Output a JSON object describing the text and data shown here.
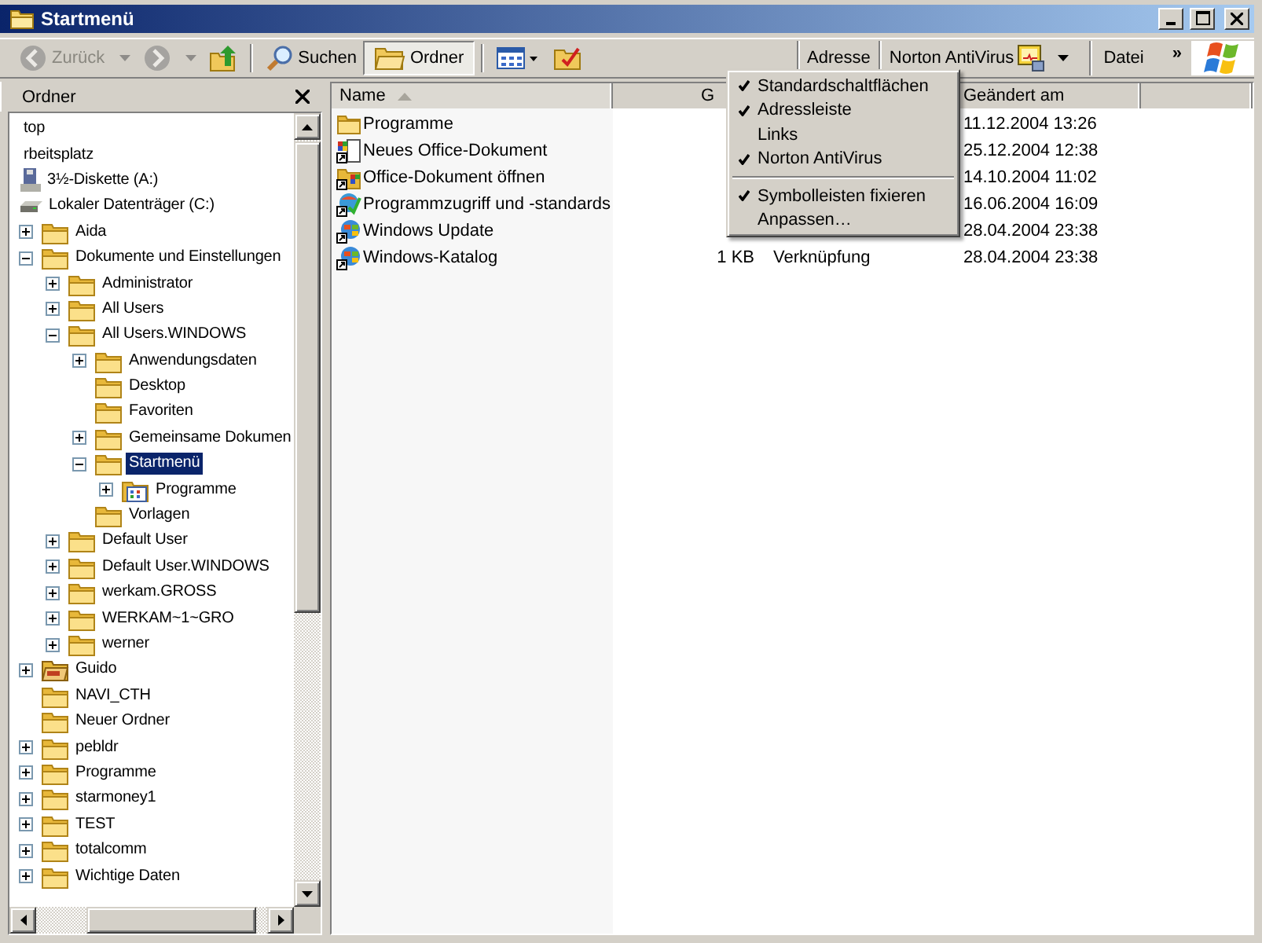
{
  "window": {
    "title": "Startmenü"
  },
  "toolbar": {
    "buttons": [
      {
        "kind": "back",
        "label": "Zurück",
        "disabled": true,
        "pressed": false
      },
      {
        "kind": "forward",
        "disabled": true,
        "pressed": false
      },
      {
        "kind": "up",
        "disabled": false,
        "pressed": false
      },
      {
        "kind": "search",
        "label": "Suchen",
        "disabled": false,
        "pressed": false
      },
      {
        "kind": "folders",
        "label": "Ordner",
        "disabled": false,
        "pressed": true
      },
      {
        "kind": "views",
        "disabled": false,
        "pressed": false
      },
      {
        "kind": "sync",
        "disabled": false,
        "pressed": false
      }
    ],
    "address_label": "Adresse",
    "norton_label": "Norton AntiVirus",
    "menu_item": "Datei",
    "chevron": "»"
  },
  "folder_pane": {
    "title": "Ordner",
    "items": [
      {
        "label": "top",
        "selected": false,
        "children": [
          {
            "label": "rbeitsplatz",
            "selected": false,
            "children": [
              {
                "label": "3½-Diskette (A:)",
                "kind": "floppy",
                "selected": false
              },
              {
                "label": "Lokaler Datenträger (C:)",
                "kind": "drive",
                "selected": false,
                "children": [
                  {
                    "label": "Aida",
                    "kind": "folder",
                    "expanded": false,
                    "selected": false
                  },
                  {
                    "label": "Dokumente und Einstellungen",
                    "kind": "folder",
                    "expanded": true,
                    "selected": false,
                    "children": [
                      {
                        "label": "Administrator",
                        "kind": "folder",
                        "expanded": false,
                        "selected": false
                      },
                      {
                        "label": "All Users",
                        "kind": "folder",
                        "expanded": false,
                        "selected": false
                      },
                      {
                        "label": "All Users.WINDOWS",
                        "kind": "folder",
                        "expanded": true,
                        "selected": false,
                        "children": [
                          {
                            "label": "Anwendungsdaten",
                            "kind": "folder",
                            "expanded": false,
                            "selected": false
                          },
                          {
                            "label": "Desktop",
                            "kind": "folder",
                            "selected": false
                          },
                          {
                            "label": "Favoriten",
                            "kind": "folder",
                            "selected": false
                          },
                          {
                            "label": "Gemeinsame Dokumen",
                            "kind": "folder",
                            "expanded": false,
                            "selected": false
                          },
                          {
                            "label": "Startmenü",
                            "kind": "folder",
                            "expanded": true,
                            "selected": true,
                            "children": [
                              {
                                "label": "Programme",
                                "kind": "programs",
                                "expanded": false,
                                "selected": false
                              }
                            ]
                          },
                          {
                            "label": "Vorlagen",
                            "kind": "folder",
                            "selected": false
                          }
                        ]
                      },
                      {
                        "label": "Default User",
                        "kind": "folder",
                        "expanded": false,
                        "selected": false
                      },
                      {
                        "label": "Default User.WINDOWS",
                        "kind": "folder",
                        "expanded": false,
                        "selected": false
                      },
                      {
                        "label": "werkam.GROSS",
                        "kind": "folder",
                        "expanded": false,
                        "selected": false
                      },
                      {
                        "label": "WERKAM~1~GRO",
                        "kind": "folder",
                        "expanded": false,
                        "selected": false
                      },
                      {
                        "label": "werner",
                        "kind": "folder",
                        "expanded": false,
                        "selected": false
                      }
                    ]
                  },
                  {
                    "label": "Guido",
                    "kind": "shared",
                    "expanded": false,
                    "selected": false
                  },
                  {
                    "label": "NAVI_CTH",
                    "kind": "folder",
                    "selected": false
                  },
                  {
                    "label": "Neuer Ordner",
                    "kind": "folder",
                    "selected": false
                  },
                  {
                    "label": "pebldr",
                    "kind": "folder",
                    "expanded": false,
                    "selected": false
                  },
                  {
                    "label": "Programme",
                    "kind": "folder",
                    "expanded": false,
                    "selected": false
                  },
                  {
                    "label": "starmoney1",
                    "kind": "folder",
                    "expanded": false,
                    "selected": false
                  },
                  {
                    "label": "TEST",
                    "kind": "folder",
                    "expanded": false,
                    "selected": false
                  },
                  {
                    "label": "totalcomm",
                    "kind": "folder",
                    "expanded": false,
                    "selected": false
                  },
                  {
                    "label": "Wichtige Daten",
                    "kind": "folder",
                    "expanded": false,
                    "selected": false
                  }
                ]
              }
            ]
          }
        ]
      }
    ]
  },
  "file_list": {
    "columns": [
      {
        "label": "Name",
        "sorted": true
      },
      {
        "label": "G"
      },
      {},
      {
        "label": "Geändert am",
        "sorted": false
      },
      {
        "sorted": false
      }
    ],
    "rows": [
      {
        "name": "Programme",
        "kind": "folder",
        "modified": "11.12.2004 13:26"
      },
      {
        "name": "Neues Office-Dokument",
        "kind": "office-new",
        "modified": "25.12.2004 12:38"
      },
      {
        "name": "Office-Dokument öffnen",
        "kind": "office-open",
        "modified": "14.10.2004 11:02"
      },
      {
        "name": "Programmzugriff und -standards",
        "kind": "access",
        "modified": "16.06.2004 16:09"
      },
      {
        "name": "Windows Update",
        "kind": "globe",
        "modified": "28.04.2004 23:38"
      },
      {
        "name": "Windows-Katalog",
        "kind": "globe",
        "size": "1 KB",
        "type": "Verknüpfung",
        "modified": "28.04.2004 23:38"
      }
    ]
  },
  "context_menu": {
    "items": [
      {
        "kind": "item",
        "label": "Standardschaltflächen",
        "checked": true
      },
      {
        "kind": "item",
        "label": "Adressleiste",
        "checked": true
      },
      {
        "kind": "item",
        "label": "Links",
        "checked": false
      },
      {
        "kind": "item",
        "label": "Norton AntiVirus",
        "checked": true
      },
      {
        "kind": "separator"
      },
      {
        "kind": "item",
        "label": "Symbolleisten fixieren",
        "checked": true
      },
      {
        "kind": "item",
        "label": "Anpassen…",
        "checked": false
      }
    ]
  }
}
